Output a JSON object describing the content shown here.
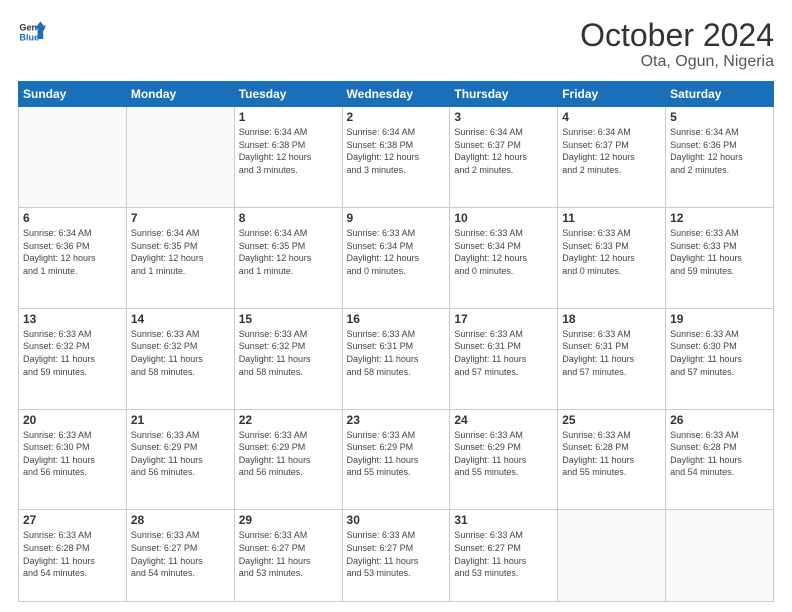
{
  "header": {
    "logo_general": "General",
    "logo_blue": "Blue",
    "month_title": "October 2024",
    "location": "Ota, Ogun, Nigeria"
  },
  "weekdays": [
    "Sunday",
    "Monday",
    "Tuesday",
    "Wednesday",
    "Thursday",
    "Friday",
    "Saturday"
  ],
  "weeks": [
    [
      {
        "day": "",
        "info": ""
      },
      {
        "day": "",
        "info": ""
      },
      {
        "day": "1",
        "info": "Sunrise: 6:34 AM\nSunset: 6:38 PM\nDaylight: 12 hours\nand 3 minutes."
      },
      {
        "day": "2",
        "info": "Sunrise: 6:34 AM\nSunset: 6:38 PM\nDaylight: 12 hours\nand 3 minutes."
      },
      {
        "day": "3",
        "info": "Sunrise: 6:34 AM\nSunset: 6:37 PM\nDaylight: 12 hours\nand 2 minutes."
      },
      {
        "day": "4",
        "info": "Sunrise: 6:34 AM\nSunset: 6:37 PM\nDaylight: 12 hours\nand 2 minutes."
      },
      {
        "day": "5",
        "info": "Sunrise: 6:34 AM\nSunset: 6:36 PM\nDaylight: 12 hours\nand 2 minutes."
      }
    ],
    [
      {
        "day": "6",
        "info": "Sunrise: 6:34 AM\nSunset: 6:36 PM\nDaylight: 12 hours\nand 1 minute."
      },
      {
        "day": "7",
        "info": "Sunrise: 6:34 AM\nSunset: 6:35 PM\nDaylight: 12 hours\nand 1 minute."
      },
      {
        "day": "8",
        "info": "Sunrise: 6:34 AM\nSunset: 6:35 PM\nDaylight: 12 hours\nand 1 minute."
      },
      {
        "day": "9",
        "info": "Sunrise: 6:33 AM\nSunset: 6:34 PM\nDaylight: 12 hours\nand 0 minutes."
      },
      {
        "day": "10",
        "info": "Sunrise: 6:33 AM\nSunset: 6:34 PM\nDaylight: 12 hours\nand 0 minutes."
      },
      {
        "day": "11",
        "info": "Sunrise: 6:33 AM\nSunset: 6:33 PM\nDaylight: 12 hours\nand 0 minutes."
      },
      {
        "day": "12",
        "info": "Sunrise: 6:33 AM\nSunset: 6:33 PM\nDaylight: 11 hours\nand 59 minutes."
      }
    ],
    [
      {
        "day": "13",
        "info": "Sunrise: 6:33 AM\nSunset: 6:32 PM\nDaylight: 11 hours\nand 59 minutes."
      },
      {
        "day": "14",
        "info": "Sunrise: 6:33 AM\nSunset: 6:32 PM\nDaylight: 11 hours\nand 58 minutes."
      },
      {
        "day": "15",
        "info": "Sunrise: 6:33 AM\nSunset: 6:32 PM\nDaylight: 11 hours\nand 58 minutes."
      },
      {
        "day": "16",
        "info": "Sunrise: 6:33 AM\nSunset: 6:31 PM\nDaylight: 11 hours\nand 58 minutes."
      },
      {
        "day": "17",
        "info": "Sunrise: 6:33 AM\nSunset: 6:31 PM\nDaylight: 11 hours\nand 57 minutes."
      },
      {
        "day": "18",
        "info": "Sunrise: 6:33 AM\nSunset: 6:31 PM\nDaylight: 11 hours\nand 57 minutes."
      },
      {
        "day": "19",
        "info": "Sunrise: 6:33 AM\nSunset: 6:30 PM\nDaylight: 11 hours\nand 57 minutes."
      }
    ],
    [
      {
        "day": "20",
        "info": "Sunrise: 6:33 AM\nSunset: 6:30 PM\nDaylight: 11 hours\nand 56 minutes."
      },
      {
        "day": "21",
        "info": "Sunrise: 6:33 AM\nSunset: 6:29 PM\nDaylight: 11 hours\nand 56 minutes."
      },
      {
        "day": "22",
        "info": "Sunrise: 6:33 AM\nSunset: 6:29 PM\nDaylight: 11 hours\nand 56 minutes."
      },
      {
        "day": "23",
        "info": "Sunrise: 6:33 AM\nSunset: 6:29 PM\nDaylight: 11 hours\nand 55 minutes."
      },
      {
        "day": "24",
        "info": "Sunrise: 6:33 AM\nSunset: 6:29 PM\nDaylight: 11 hours\nand 55 minutes."
      },
      {
        "day": "25",
        "info": "Sunrise: 6:33 AM\nSunset: 6:28 PM\nDaylight: 11 hours\nand 55 minutes."
      },
      {
        "day": "26",
        "info": "Sunrise: 6:33 AM\nSunset: 6:28 PM\nDaylight: 11 hours\nand 54 minutes."
      }
    ],
    [
      {
        "day": "27",
        "info": "Sunrise: 6:33 AM\nSunset: 6:28 PM\nDaylight: 11 hours\nand 54 minutes."
      },
      {
        "day": "28",
        "info": "Sunrise: 6:33 AM\nSunset: 6:27 PM\nDaylight: 11 hours\nand 54 minutes."
      },
      {
        "day": "29",
        "info": "Sunrise: 6:33 AM\nSunset: 6:27 PM\nDaylight: 11 hours\nand 53 minutes."
      },
      {
        "day": "30",
        "info": "Sunrise: 6:33 AM\nSunset: 6:27 PM\nDaylight: 11 hours\nand 53 minutes."
      },
      {
        "day": "31",
        "info": "Sunrise: 6:33 AM\nSunset: 6:27 PM\nDaylight: 11 hours\nand 53 minutes."
      },
      {
        "day": "",
        "info": ""
      },
      {
        "day": "",
        "info": ""
      }
    ]
  ]
}
